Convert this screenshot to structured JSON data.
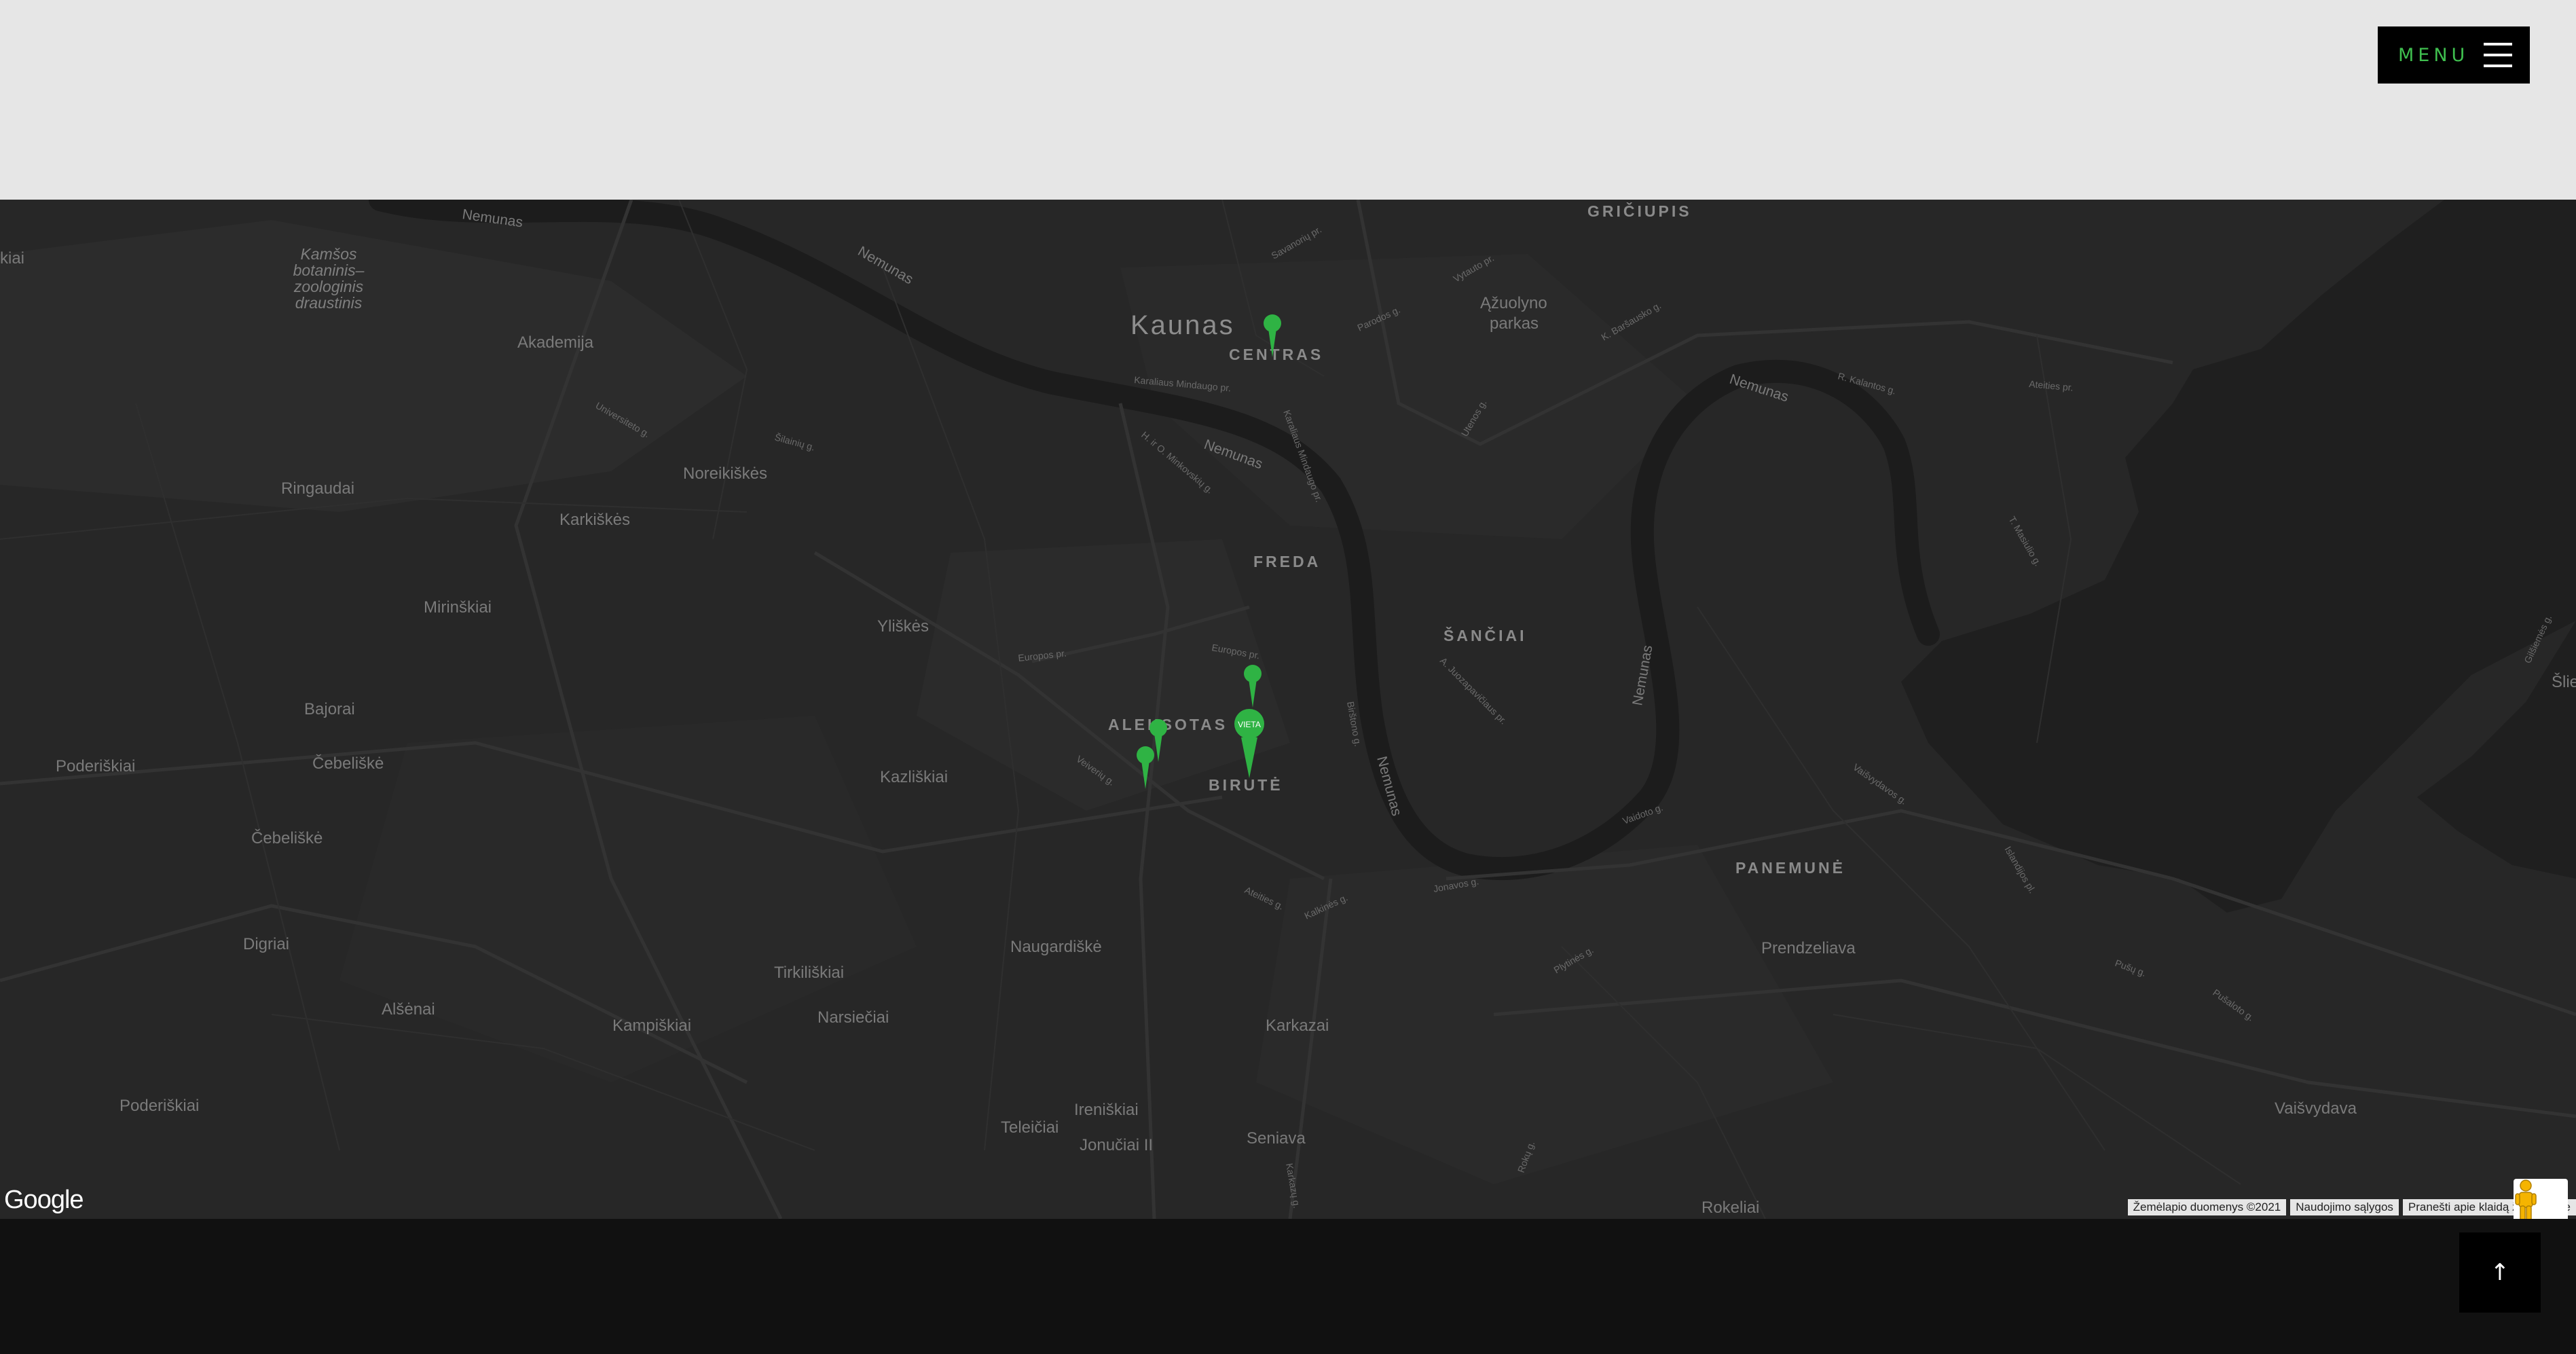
{
  "header": {
    "menu_label": "MENU"
  },
  "map": {
    "city": "Kaunas",
    "districts": [
      "CENTRAS",
      "GRIČIUPIS",
      "FREDA",
      "ŠANČIAI",
      "ALEKSOTAS",
      "BIRUTĖ",
      "PANEMUNĖ"
    ],
    "places": [
      "Akademija",
      "Noreikiškės",
      "Karkiškės",
      "Ringaudai",
      "Mirinškiai",
      "Bajorai",
      "Poderiškiai",
      "Čebeliškė",
      "Čebeliškė",
      "Digriai",
      "Alšėnai",
      "Kampiškiai",
      "Poderiškiai",
      "Yliškės",
      "Kazliškiai",
      "Naugardiškė",
      "Tirkiliškiai",
      "Narsiečiai",
      "Karkazai",
      "Ireniškiai",
      "Teleičiai",
      "Jonučiai II",
      "Seniava",
      "Prendzeliava",
      "Vaišvydava",
      "Rokeliai",
      "Ąžuolyno",
      "parkas",
      "kiai",
      "Šlie"
    ],
    "park_label": [
      "Kamšos",
      "botaninis–",
      "zoologinis",
      "draustinis"
    ],
    "rivers": [
      "Nemunas",
      "Nemunas",
      "Nemunas",
      "Nemunas",
      "Nemunas",
      "Nemunas"
    ],
    "streets": [
      "Savanorių pr.",
      "Vytauto pr.",
      "Parodos g.",
      "K. Baršausko g.",
      "R. Kalantos g.",
      "Ateities pr.",
      "Karaliaus Mindaugo pr.",
      "Utenos g.",
      "Universiteto g.",
      "Šilainių g.",
      "H. ir O. Minkovskių g.",
      "Karaliaus Mindaugo pr.",
      "Europos pr.",
      "Europos pr.",
      "Veiverių g.",
      "Birštono g.",
      "Pilaitės g.",
      "A. Juozapavičiaus pr.",
      "Vaidoto g.",
      "Vaišvydavos g.",
      "Islandijos pl.",
      "Taikos pr.",
      "Jonavos g.",
      "Kalkinės g.",
      "Ateities g.",
      "T. Masiulio g.",
      "Kalantos g.",
      "Pušų g.",
      "Plytinės g.",
      "Karkazų g.",
      "Rokų g.",
      "Gilšiemės g.",
      "Baltų pr.",
      "Pušaloto g.",
      "Jonavos g."
    ],
    "marker_label": "VIETA",
    "colors": {
      "marker": "#2fb344",
      "land": "#272727",
      "water": "#1e1e1e",
      "road": "#333333"
    }
  },
  "map_controls": {
    "google_logo": "Google",
    "attribution": [
      "Žemėlapio duomenys ©2021",
      "Naudojimo sąlygos",
      "Pranešti apie klaidą žemėlapyje"
    ],
    "zoom_in": "+",
    "zoom_out": "−"
  },
  "footer": {
    "scroll_top_symbol": "↑"
  }
}
